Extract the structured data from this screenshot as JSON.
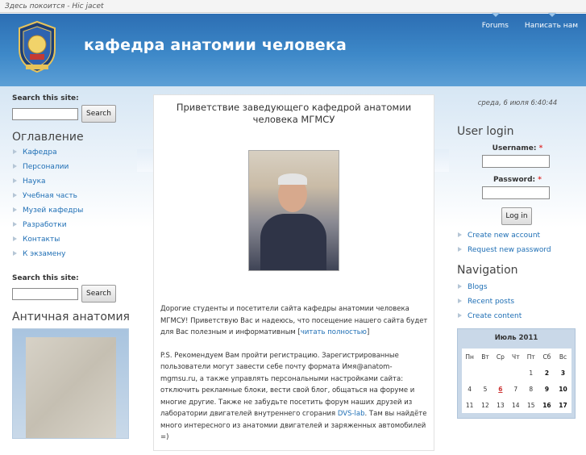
{
  "topstrip": {
    "text": "Здесь покоится - Hic jacet"
  },
  "header": {
    "site_title": "кафедра анатомии человека",
    "nav": [
      {
        "label": "Forums"
      },
      {
        "label": "Написать нам"
      }
    ]
  },
  "left": {
    "search1": {
      "label": "Search this site:",
      "button": "Search"
    },
    "toc_title": "Оглавление",
    "menu": [
      {
        "label": "Кафедра"
      },
      {
        "label": "Персоналии"
      },
      {
        "label": "Наука"
      },
      {
        "label": "Учебная часть"
      },
      {
        "label": "Музей кафедры"
      },
      {
        "label": "Разработки"
      },
      {
        "label": "Контакты"
      },
      {
        "label": "К экзамену"
      }
    ],
    "search2": {
      "label": "Search this site:",
      "button": "Search"
    },
    "antique_title": "Античная анатомия"
  },
  "main": {
    "title": "Приветствие заведующего кафедрой анатомии человека МГМСУ",
    "para1": "Дорогие студенты и посетители сайта кафедры анатомии человека МГМСУ! Приветствую Вас и надеюсь, что посещение нашего сайта будет для Вас полезным и информативным [",
    "para1_link": "читать полностью",
    "para1_end": "]",
    "para2": "P.S. Рекомендуем Вам пройти регистрацию. Зарегистрированные пользователи могут завести себе почту формата Имя@anatom-mgmsu.ru, а также управлять персональными настройками сайта: отключить рекламные блоки, вести свой блог, общаться на форуме и многие другие. Также не забудьте посетить форум наших друзей из лаборатории двигателей внутреннего сгорания ",
    "para2_link": "DVS-lab",
    "para2_end": ". Там вы найдёте много интересного из анатомии двигателей и заряженных автомобилей =)"
  },
  "right": {
    "date": "среда, 6 июля 6:40:44",
    "login_title": "User login",
    "username_label": "Username:",
    "password_label": "Password:",
    "required_mark": "*",
    "login_button": "Log in",
    "links": [
      {
        "label": "Create new account"
      },
      {
        "label": "Request new password"
      }
    ],
    "nav_title": "Navigation",
    "nav": [
      {
        "label": "Blogs"
      },
      {
        "label": "Recent posts"
      },
      {
        "label": "Create content"
      }
    ],
    "calendar": {
      "month": "Июль 2011",
      "days": [
        "Пн",
        "Вт",
        "Ср",
        "Чт",
        "Пт",
        "Сб",
        "Вс"
      ],
      "weeks": [
        [
          "",
          "",
          "",
          "",
          "1",
          "2",
          "3"
        ],
        [
          "4",
          "5",
          "6",
          "7",
          "8",
          "9",
          "10"
        ],
        [
          "11",
          "12",
          "13",
          "14",
          "15",
          "16",
          "17"
        ]
      ],
      "today": "6"
    }
  }
}
